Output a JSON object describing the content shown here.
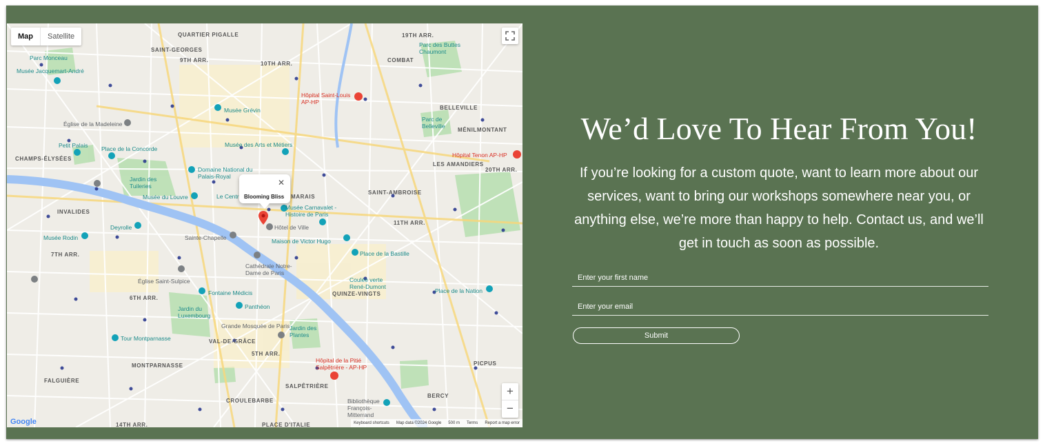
{
  "map": {
    "type_tabs": [
      "Map",
      "Satellite"
    ],
    "info_window_title": "Blooming Bliss",
    "google_logo": "Google",
    "attribution": [
      "Keyboard shortcuts",
      "Map data ©2024 Google",
      "500 m",
      "Terms",
      "Report a map error"
    ],
    "district_labels": [
      "QUARTIER PIGALLE",
      "19TH ARR.",
      "SAINT-GEORGES",
      "9TH ARR.",
      "10TH ARR.",
      "COMBAT",
      "BELLEVILLE",
      "MÉNILMONTANT",
      "CHAMPS-ÉLYSÉES",
      "LES AMANDIERS",
      "20TH ARR.",
      "INVALIDES",
      "MARAIS",
      "SAINT-AMBROISE",
      "11TH ARR.",
      "7TH ARR.",
      "6TH ARR.",
      "QUINZE-VINGTS",
      "VAL-DE-GRÂCE",
      "5TH ARR.",
      "MONTPARNASSE",
      "PICPUS",
      "FALGUIÈRE",
      "SALPÊTRIÈRE",
      "BERCY",
      "CROULEBARBE",
      "14TH ARR.",
      "PLACE D'ITALIE"
    ],
    "poi_labels": [
      "Parc Monceau",
      "Musée Jacquemart-André",
      "Parc des Buttes Chaumont",
      "Musée Grévin",
      "Église de la Madeleine",
      "Petit Palais",
      "Place de la Concorde",
      "Musée des Arts et Métiers",
      "Domaine National du Palais-Royal",
      "Jardin des Tuileries",
      "Musée du Louvre",
      "Le Centre Pompidou",
      "Musée Carnavalet - Histoire de Paris",
      "Hôtel de Ville",
      "Sainte-Chapelle",
      "Maison de Victor Hugo",
      "Place de la Bastille",
      "Deyrolle",
      "Musée Rodin",
      "Cathédrale Notre-Dame de Paris",
      "Église Saint-Sulpice",
      "Fontaine Médicis",
      "Panthéon",
      "Jardin du Luxembourg",
      "Coulée verte René-Dumont",
      "Place de la Nation",
      "Grande Mosquée de Paris",
      "Jardin des Plantes",
      "Tour Montparnasse",
      "Bibliothèque François-Mitterrand",
      "Parc de Belleville"
    ],
    "hospital_labels": [
      "Hôpital Saint-Louis AP-HP",
      "Hôpital Tenon AP-HP",
      "Hôpital de la Pitié Salpêtrière - AP-HP"
    ],
    "colors": {
      "water": "#9fc3f4",
      "park": "#b9dfb2",
      "urban": "#f1efe9",
      "road": "#ffffff",
      "arterial": "#fde293",
      "marker": "#ea4335"
    }
  },
  "contact": {
    "heading": "We’d Love To Hear From You!",
    "intro_lines": [
      "If you’re looking for a custom quote, want to learn more about our",
      "services, want to bring our workshops somewhere near you, or",
      "anything else, we’re more than happy to help. Contact us, and we’ll",
      "get in touch as soon as possible."
    ],
    "first_name_placeholder": "Enter your first name",
    "email_placeholder": "Enter your email",
    "submit_label": "Submit"
  },
  "colors": {
    "panel_bg": "#5a7352",
    "text": "#ffffff"
  }
}
